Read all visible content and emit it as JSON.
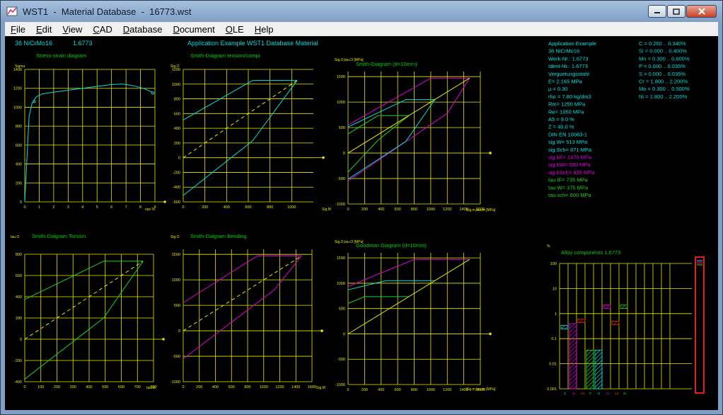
{
  "window": {
    "title": "WST1  -  Material Database  -  16773.wst"
  },
  "menu": [
    {
      "label": "File",
      "accel": "F"
    },
    {
      "label": "Edit",
      "accel": "E"
    },
    {
      "label": "View",
      "accel": "V"
    },
    {
      "label": "CAD",
      "accel": "C"
    },
    {
      "label": "Database",
      "accel": "D"
    },
    {
      "label": "Document",
      "accel": "D"
    },
    {
      "label": "OLE",
      "accel": "O"
    },
    {
      "label": "Help",
      "accel": "H"
    }
  ],
  "header": {
    "material": "36 NiCrMo16",
    "number": "1.6773",
    "caption": "Application Example  WST1 Database  Material"
  },
  "colors": {
    "grid": "#e8e800",
    "axis": "#e8e800",
    "label": "#00d000",
    "cyan": "#00e0e0",
    "magenta": "#e000e0",
    "green": "#20d020",
    "text": "#00d8d8"
  },
  "properties_left": [
    {
      "text": "Application Example",
      "color": "cyan"
    },
    {
      "text": "36 NiCrMo16",
      "color": "cyan"
    },
    {
      "text": "Werk-Nr.: 1.6773",
      "color": "cyan"
    },
    {
      "text": "Ident-Nr.: 1.6773",
      "color": "cyan"
    },
    {
      "text": "Verguetungsstahl",
      "color": "cyan"
    },
    {
      "text": "E= 2.165 MPa",
      "color": "cyan"
    },
    {
      "text": "μ = 0.30",
      "color": "cyan"
    },
    {
      "text": "rho = 7.80 kg/dm3",
      "color": "cyan"
    },
    {
      "text": "Rm= 1250 MPa",
      "color": "cyan"
    },
    {
      "text": "Re= 1050 MPa",
      "color": "cyan"
    },
    {
      "text": "A5 = 9.0 %",
      "color": "cyan"
    },
    {
      "text": "Z = 40.0 %",
      "color": "cyan"
    },
    {
      "text": "DIN EN 10083-1",
      "color": "cyan"
    },
    {
      "text": "sig.W= 513 MPa",
      "color": "cyan"
    },
    {
      "text": "sig.Sch= 871 MPa",
      "color": "cyan"
    },
    {
      "text": "sig.bF= 1470 MPa",
      "color": "magenta"
    },
    {
      "text": "sig.bW= 550 MPa",
      "color": "magenta"
    },
    {
      "text": "sig.bSch= 935 MPa",
      "color": "magenta"
    },
    {
      "text": "tau tF= 735 MPa",
      "color": "green"
    },
    {
      "text": "tau W= 375 MPa",
      "color": "green"
    },
    {
      "text": "tau sch= 600 MPa",
      "color": "green"
    }
  ],
  "properties_right": [
    "C = 0.260 .. 0.340%",
    "Si = 0.000 .. 0.400%",
    "Mn = 0.300 .. 0.600%",
    "P = 0.000 .. 0.035%",
    "S = 0.000 .. 0.035%",
    "Cr = 1.800 .. 2.200%",
    "Mo = 0.300 .. 0.500%",
    "Ni = 1.800 .. 2.200%"
  ],
  "chart_data": [
    {
      "id": "stress_strain",
      "type": "line",
      "title": "Stress-strain diagram",
      "ylabel": "Sigma",
      "xlabel": "eps %",
      "xlim": [
        0,
        9
      ],
      "ylim": [
        0,
        1400
      ],
      "xticks": [
        "0",
        "1",
        "2",
        "3",
        "4",
        "5",
        "6",
        "7",
        "8",
        "9"
      ],
      "yticks": [
        "0",
        "200",
        "400",
        "600",
        "800",
        "1000",
        "1200",
        "1400"
      ],
      "series": [
        {
          "color": "cyan",
          "points": [
            [
              0,
              0
            ],
            [
              0.3,
              900
            ],
            [
              0.5,
              1040
            ],
            [
              0.8,
              1110
            ],
            [
              1.2,
              1140
            ],
            [
              2,
              1160
            ],
            [
              3,
              1180
            ],
            [
              4,
              1200
            ],
            [
              5,
              1220
            ],
            [
              6,
              1240
            ],
            [
              6.8,
              1245
            ],
            [
              7.4,
              1230
            ],
            [
              8.2,
              1200
            ],
            [
              8.8,
              1160
            ]
          ]
        }
      ],
      "markers": [
        [
          0.65,
          1060
        ],
        [
          8.85,
          1150
        ]
      ]
    },
    {
      "id": "smith_tc",
      "type": "line",
      "title": "Smith-Diagram tension/compr.",
      "ylabel": "Sig.O",
      "xlabel": "Sig.M",
      "xlim": [
        0,
        1200
      ],
      "ylim": [
        -600,
        1200
      ],
      "xticks": [
        "0",
        "200",
        "400",
        "600",
        "800",
        "1000"
      ],
      "yticks": [
        "-600",
        "-400",
        "-200",
        "0",
        "200",
        "400",
        "600",
        "800",
        "1000",
        "1200"
      ],
      "series": [
        {
          "color": "cyan",
          "points": [
            [
              0,
              513
            ],
            [
              640,
              1050
            ],
            [
              1050,
              1050
            ]
          ]
        },
        {
          "color": "cyan",
          "points": [
            [
              0,
              -513
            ],
            [
              640,
              230
            ],
            [
              1050,
              1050
            ]
          ]
        },
        {
          "color": "yellow",
          "dashed": true,
          "points": [
            [
              0,
              0
            ],
            [
              1050,
              1050
            ]
          ]
        }
      ]
    },
    {
      "id": "smith_10",
      "type": "line",
      "title": "Smith-Diagram (d=10mm)",
      "ylabel": "Sig.O,tau.O [MPa]",
      "xlabel": "Sig.m,tau.m [MPa]",
      "xlim": [
        0,
        1600
      ],
      "ylim": [
        -1000,
        1600
      ],
      "xticks": [
        "0",
        "200",
        "400",
        "600",
        "800",
        "1000",
        "1200",
        "1400",
        "1600"
      ],
      "yticks": [
        "-1000",
        "-500",
        "0",
        "500",
        "1000",
        "1500"
      ],
      "series": [
        {
          "color": "magenta",
          "points": [
            [
              0,
              550
            ],
            [
              1000,
              1470
            ],
            [
              1470,
              1470
            ]
          ]
        },
        {
          "color": "magenta",
          "points": [
            [
              0,
              -550
            ],
            [
              1200,
              780
            ],
            [
              1470,
              1470
            ]
          ]
        },
        {
          "color": "cyan",
          "points": [
            [
              0,
              513
            ],
            [
              700,
              1050
            ],
            [
              1050,
              1050
            ]
          ]
        },
        {
          "color": "cyan",
          "points": [
            [
              0,
              -513
            ],
            [
              700,
              230
            ],
            [
              1050,
              1050
            ]
          ]
        },
        {
          "color": "green",
          "points": [
            [
              0,
              375
            ],
            [
              360,
              735
            ],
            [
              735,
              735
            ]
          ]
        },
        {
          "color": "green",
          "points": [
            [
              0,
              -375
            ],
            [
              360,
              250
            ],
            [
              735,
              735
            ]
          ]
        },
        {
          "color": "yellow",
          "points": [
            [
              0,
              0
            ],
            [
              1470,
              1470
            ]
          ]
        }
      ]
    },
    {
      "id": "smith_torsion",
      "type": "line",
      "title": "Smith-Diagram Torsion",
      "ylabel": "tau.O",
      "xlabel": "tau.M",
      "xlim": [
        0,
        800
      ],
      "ylim": [
        -400,
        800
      ],
      "xticks": [
        "0",
        "100",
        "200",
        "300",
        "400",
        "500",
        "600",
        "700",
        "800"
      ],
      "yticks": [
        "-400",
        "-200",
        "0",
        "200",
        "400",
        "600",
        "800"
      ],
      "series": [
        {
          "color": "green",
          "points": [
            [
              0,
              375
            ],
            [
              490,
              735
            ],
            [
              735,
              735
            ]
          ]
        },
        {
          "color": "green",
          "points": [
            [
              0,
              -375
            ],
            [
              490,
              200
            ],
            [
              735,
              735
            ]
          ]
        },
        {
          "color": "yellow",
          "dashed": true,
          "points": [
            [
              0,
              0
            ],
            [
              735,
              735
            ]
          ]
        }
      ]
    },
    {
      "id": "smith_bending",
      "type": "line",
      "title": "Smith-Diagram Bending",
      "ylabel": "Sig.O",
      "xlabel": "Sig.M",
      "xlim": [
        0,
        1600
      ],
      "ylim": [
        -1000,
        1600
      ],
      "xticks": [
        "0",
        "200",
        "400",
        "600",
        "800",
        "1000",
        "1200",
        "1400",
        "1600"
      ],
      "yticks": [
        "-1000",
        "-500",
        "0",
        "500",
        "1000",
        "1500"
      ],
      "series": [
        {
          "color": "magenta",
          "points": [
            [
              0,
              550
            ],
            [
              920,
              1470
            ],
            [
              1470,
              1470
            ]
          ]
        },
        {
          "color": "magenta",
          "points": [
            [
              0,
              -550
            ],
            [
              1130,
              800
            ],
            [
              1470,
              1470
            ]
          ]
        },
        {
          "color": "yellow",
          "dashed": true,
          "points": [
            [
              0,
              0
            ],
            [
              1470,
              1470
            ]
          ]
        }
      ]
    },
    {
      "id": "goodman",
      "type": "line",
      "title": "Goodman Diagram (d=10mm)",
      "ylabel": "Sig.O,tau.O [MPa]",
      "xlabel": "Sig.m,tau.m [MPa]",
      "xlim": [
        0,
        1600
      ],
      "ylim": [
        -1000,
        1600
      ],
      "xticks": [
        "0",
        "200",
        "400",
        "600",
        "800",
        "1000",
        "1200",
        "1400",
        "1600"
      ],
      "yticks": [
        "-1000",
        "-500",
        "0",
        "500",
        "1000",
        "1500"
      ],
      "series": [
        {
          "color": "magenta",
          "points": [
            [
              0,
              935
            ],
            [
              800,
              1470
            ],
            [
              1470,
              1470
            ]
          ]
        },
        {
          "color": "cyan",
          "points": [
            [
              0,
              870
            ],
            [
              460,
              1050
            ],
            [
              1050,
              1050
            ]
          ]
        },
        {
          "color": "green",
          "points": [
            [
              0,
              600
            ],
            [
              200,
              735
            ],
            [
              735,
              735
            ]
          ]
        },
        {
          "color": "yellow",
          "points": [
            [
              0,
              0
            ],
            [
              1470,
              1470
            ]
          ]
        }
      ]
    },
    {
      "id": "alloy",
      "type": "bar",
      "title": "Alloy components 1.6773",
      "ylabel": "%",
      "scale": "log",
      "ylim": [
        0.001,
        100
      ],
      "yticks": [
        "0,001",
        "0,01",
        "0,1",
        "1",
        "10",
        "100"
      ],
      "categories": [
        "C",
        "Si",
        "Mn",
        "P",
        "S",
        "Cr",
        "Mo",
        "Ni"
      ],
      "bars": [
        {
          "element": "C",
          "min": 0.26,
          "max": 0.34,
          "color": "cyan"
        },
        {
          "element": "Si",
          "min": 0.0,
          "max": 0.4,
          "color": "magenta"
        },
        {
          "element": "Mn",
          "min": 0.3,
          "max": 0.6,
          "color": "red"
        },
        {
          "element": "P",
          "min": 0.0,
          "max": 0.035,
          "color": "green"
        },
        {
          "element": "S",
          "min": 0.0,
          "max": 0.035,
          "color": "cyan"
        },
        {
          "element": "Cr",
          "min": 1.8,
          "max": 2.2,
          "color": "magenta"
        },
        {
          "element": "Mo",
          "min": 0.3,
          "max": 0.5,
          "color": "red"
        },
        {
          "element": "Ni",
          "min": 1.8,
          "max": 2.2,
          "color": "green"
        }
      ]
    }
  ]
}
